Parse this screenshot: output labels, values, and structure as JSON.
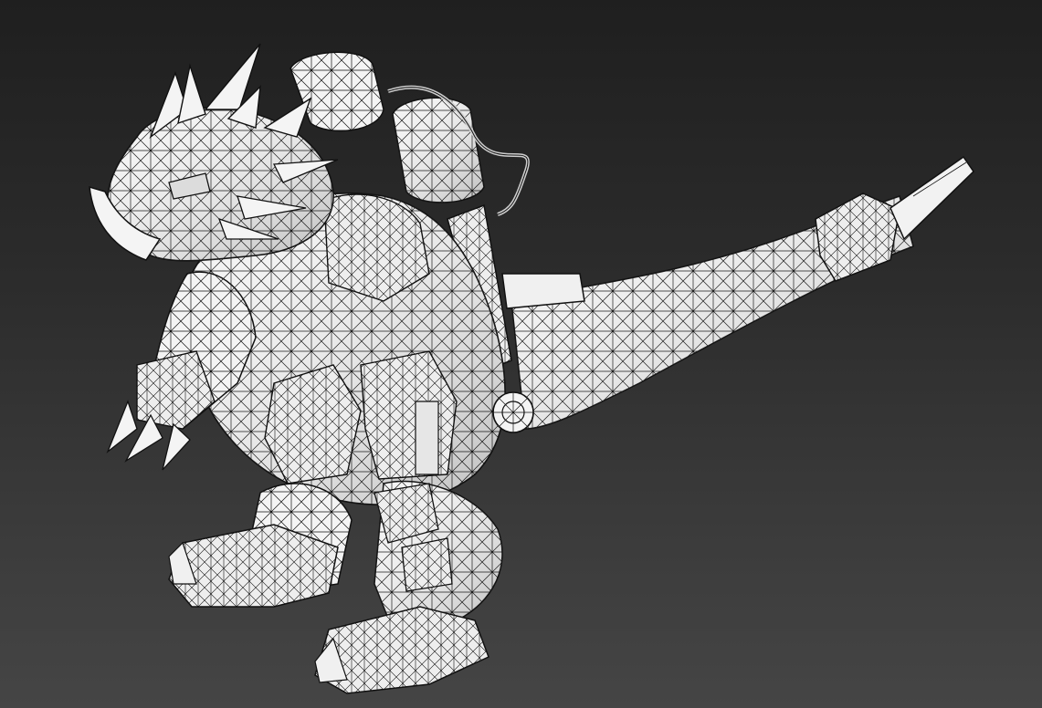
{
  "viewport": {
    "background_top": "#1f1f1f",
    "background_bottom": "#454545"
  },
  "model": {
    "subject": "mech-dinosaur-wireframe-icon",
    "surface_color": "#f4f4f4",
    "wire_color": "#111111",
    "shade_color": "#cfcfcf"
  }
}
